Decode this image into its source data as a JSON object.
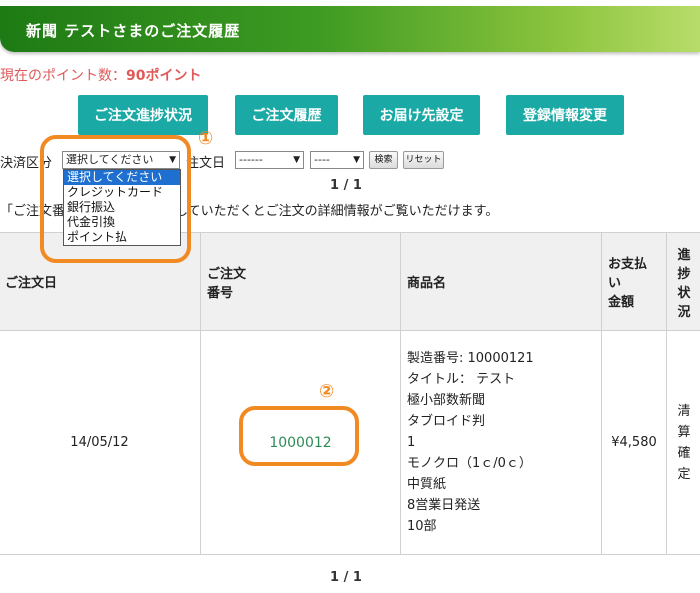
{
  "header": {
    "title": "新聞 テストさまのご注文履歴"
  },
  "points": {
    "label": "現在のポイント数：",
    "value": "90ポイント"
  },
  "nav": [
    {
      "label": "ご注文進捗状況"
    },
    {
      "label": "ご注文履歴"
    },
    {
      "label": "お届け先設定"
    },
    {
      "label": "登録情報変更"
    }
  ],
  "filter": {
    "payment_label": "決済区分",
    "payment_selected": "選択してください",
    "payment_options": [
      "選択してください",
      "クレジットカード",
      "銀行振込",
      "代金引換",
      "ポイント払"
    ],
    "order_date_label": "注文日",
    "year_value": "------",
    "month_value": "----",
    "search_label": "検索",
    "reset_label": "リセット"
  },
  "pagination": {
    "top": "1 / 1",
    "bottom": "1 / 1"
  },
  "hint": {
    "left": "「ご注文番",
    "right": "していただくとご注文の詳細情報がご覧いただけます。"
  },
  "table": {
    "headers": {
      "date": "ご注文日",
      "order_no_line1": "ご注文",
      "order_no_line2": "番号",
      "product": "商品名",
      "amount_line1": "お支払",
      "amount_line2": "い",
      "amount_line3": "金額",
      "status_line1": "進",
      "status_line2": "捗",
      "status_line3": "状",
      "status_line4": "況"
    },
    "row": {
      "date": "14/05/12",
      "order_no": "1000012",
      "product_lines": [
        "製造番号: 10000121",
        "タイトル： テスト",
        "極小部数新聞",
        "タブロイド判",
        "1",
        "モノクロ（1ｃ/0ｃ）",
        "中質紙",
        "8営業日発送",
        "10部"
      ],
      "amount": "¥4,580",
      "status_lines": [
        "清",
        "算",
        "確",
        "定"
      ]
    }
  },
  "annotations": {
    "marker1": "①",
    "marker2": "②",
    "color": "#f28a24"
  },
  "colors": {
    "nav_button": "#1aa9a5",
    "header_green": "#3d9a22",
    "points_red": "#e05a5a",
    "link_green": "#2e8b57"
  }
}
